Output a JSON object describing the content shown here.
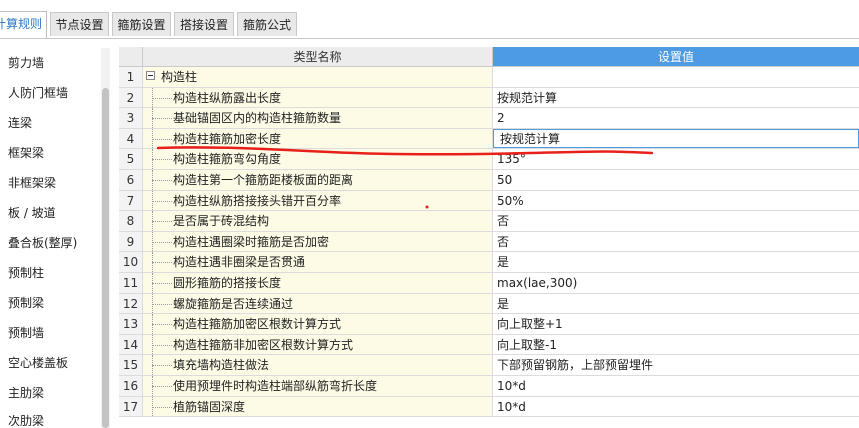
{
  "tabs": [
    {
      "label": "计算规则",
      "active": true
    },
    {
      "label": "节点设置",
      "active": false
    },
    {
      "label": "箍筋设置",
      "active": false
    },
    {
      "label": "搭接设置",
      "active": false
    },
    {
      "label": "箍筋公式",
      "active": false
    }
  ],
  "sidebar": {
    "items": [
      {
        "label": "剪力墙"
      },
      {
        "label": "人防门框墙"
      },
      {
        "label": "连梁"
      },
      {
        "label": "框架梁"
      },
      {
        "label": "非框架梁"
      },
      {
        "label": "板 / 坡道"
      },
      {
        "label": "叠合板(整厚)"
      },
      {
        "label": "预制柱"
      },
      {
        "label": "预制梁"
      },
      {
        "label": "预制墙"
      },
      {
        "label": "空心楼盖板"
      },
      {
        "label": "主肋梁"
      },
      {
        "label": "次肋梁"
      }
    ]
  },
  "grid": {
    "header": {
      "num": "",
      "name": "类型名称",
      "value": "设置值"
    },
    "rows": [
      {
        "num": "1",
        "name": "构造柱",
        "value": ""
      },
      {
        "num": "2",
        "name": "构造柱纵筋露出长度",
        "value": "按规范计算"
      },
      {
        "num": "3",
        "name": "基础锚固区内的构造柱箍筋数量",
        "value": "2"
      },
      {
        "num": "4",
        "name": "构造柱箍筋加密长度",
        "value": "按规范计算"
      },
      {
        "num": "5",
        "name": "构造柱箍筋弯勾角度",
        "value": "135°"
      },
      {
        "num": "6",
        "name": "构造柱第一个箍筋距楼板面的距离",
        "value": "50"
      },
      {
        "num": "7",
        "name": "构造柱纵筋搭接接头错开百分率",
        "value": "50%"
      },
      {
        "num": "8",
        "name": "是否属于砖混结构",
        "value": "否"
      },
      {
        "num": "9",
        "name": "构造柱遇圈梁时箍筋是否加密",
        "value": "否"
      },
      {
        "num": "10",
        "name": "构造柱遇非圈梁是否贯通",
        "value": "是"
      },
      {
        "num": "11",
        "name": "圆形箍筋的搭接长度",
        "value": "max(lae,300)"
      },
      {
        "num": "12",
        "name": "螺旋箍筋是否连续通过",
        "value": "是"
      },
      {
        "num": "13",
        "name": "构造柱箍筋加密区根数计算方式",
        "value": "向上取整+1"
      },
      {
        "num": "14",
        "name": "构造柱箍筋非加密区根数计算方式",
        "value": "向上取整-1"
      },
      {
        "num": "15",
        "name": "填充墙构造柱做法",
        "value": "下部预留钢筋，上部预留埋件"
      },
      {
        "num": "16",
        "name": "使用预埋件时构造柱端部纵筋弯折长度",
        "value": "10*d"
      },
      {
        "num": "17",
        "name": "植筋锚固深度",
        "value": "10*d"
      }
    ],
    "selected_row": "4"
  },
  "colors": {
    "accent": "#4c9be3",
    "name_cell_bg": "#fdfbe6",
    "annotation": "#e8201c"
  }
}
